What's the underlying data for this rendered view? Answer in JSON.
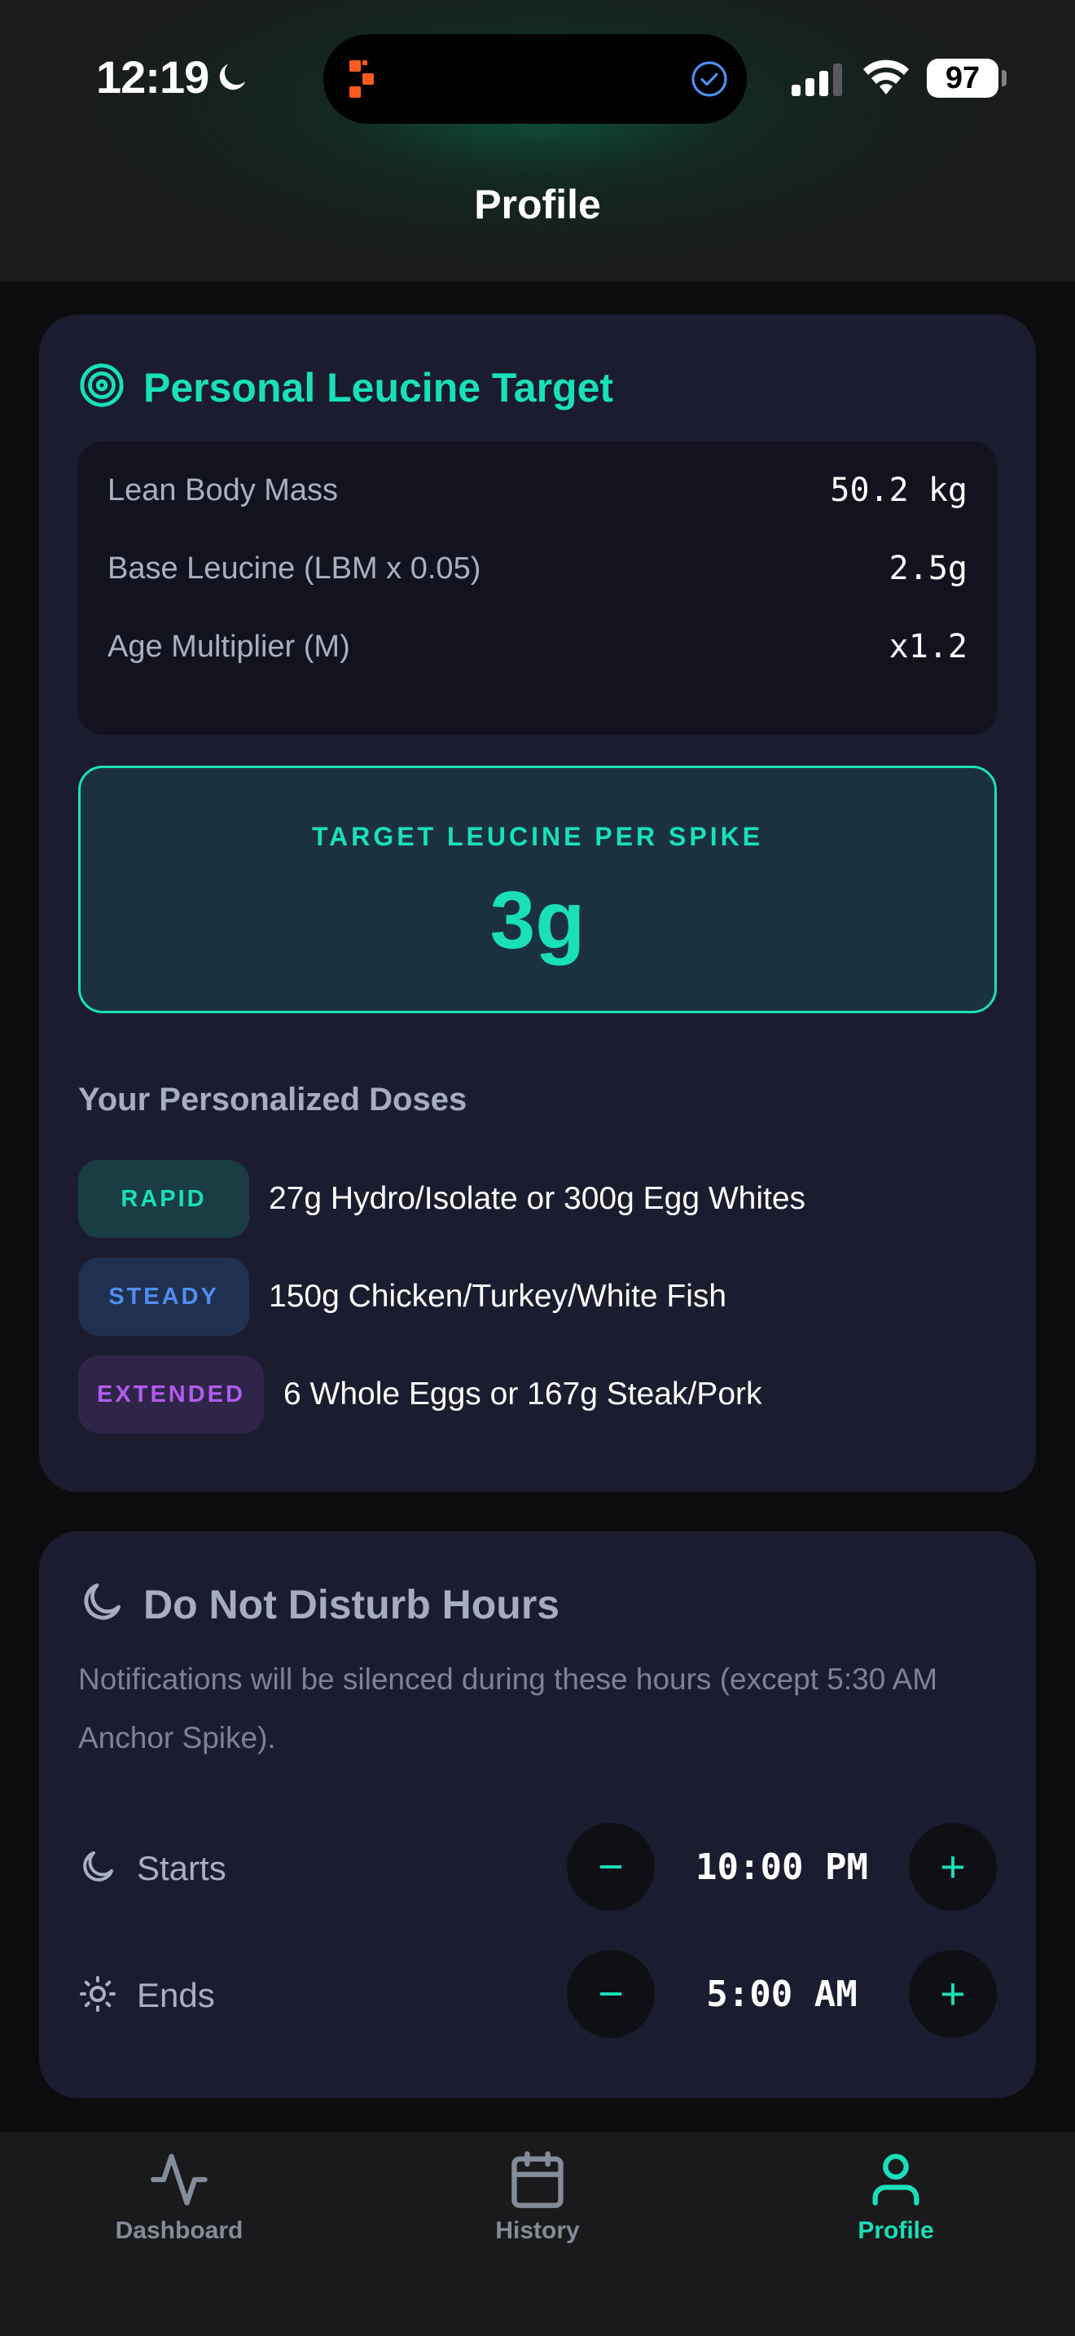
{
  "status_bar": {
    "time": "12:19",
    "battery": "97"
  },
  "header": {
    "title": "Profile"
  },
  "leucine_card": {
    "title": "Personal Leucine Target",
    "stats": [
      {
        "label": "Lean Body Mass",
        "value": "50.2 kg"
      },
      {
        "label": "Base Leucine (LBM x 0.05)",
        "value": "2.5g"
      },
      {
        "label": "Age Multiplier (M)",
        "value": "x1.2"
      }
    ],
    "target": {
      "label": "TARGET LEUCINE PER SPIKE",
      "value": "3g"
    },
    "doses_heading": "Your Personalized Doses",
    "doses": [
      {
        "badge": "RAPID",
        "text": "27g Hydro/Isolate or 300g Egg Whites"
      },
      {
        "badge": "STEADY",
        "text": "150g Chicken/Turkey/White Fish"
      },
      {
        "badge": "EXTENDED",
        "text": "6 Whole Eggs or 167g Steak/Pork"
      }
    ]
  },
  "dnd_card": {
    "title": "Do Not Disturb Hours",
    "description": "Notifications will be silenced during these hours (except 5:30 AM Anchor Spike).",
    "starts": {
      "label": "Starts",
      "value": "10:00 PM"
    },
    "ends": {
      "label": "Ends",
      "value": "5:00 AM"
    },
    "minus_symbol": "−",
    "plus_symbol": "+"
  },
  "tabbar": {
    "tabs": [
      {
        "label": "Dashboard",
        "icon": "activity-icon",
        "active": false
      },
      {
        "label": "History",
        "icon": "calendar-icon",
        "active": false
      },
      {
        "label": "Profile",
        "icon": "user-icon",
        "active": true
      }
    ]
  },
  "colors": {
    "accent": "#19e0b9",
    "rapid": "#19e0b9",
    "steady": "#4f8ef0",
    "extended": "#b25bee",
    "card": "#1b1c2f"
  }
}
